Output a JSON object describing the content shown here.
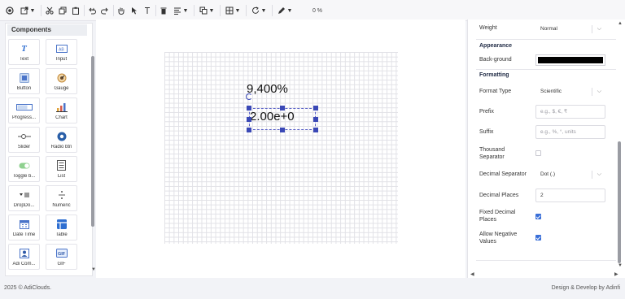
{
  "toolbar": {
    "zoom_label": "0 %",
    "icons": [
      "record-icon",
      "export-icon",
      "cut-icon",
      "copy-icon",
      "paste-icon",
      "undo-icon",
      "redo-icon",
      "hand-icon",
      "pointer-icon",
      "text-cursor-icon",
      "delete-icon",
      "align-icon",
      "layers-icon",
      "grid-icon",
      "refresh-icon",
      "pen-icon"
    ]
  },
  "components": {
    "title": "Components",
    "items": [
      {
        "label": "Text",
        "icon": "text-icon"
      },
      {
        "label": "Input",
        "icon": "input-icon"
      },
      {
        "label": "Button",
        "icon": "button-icon"
      },
      {
        "label": "Gauge",
        "icon": "gauge-icon"
      },
      {
        "label": "Progress...",
        "icon": "progress-icon"
      },
      {
        "label": "Chart",
        "icon": "chart-icon"
      },
      {
        "label": "Slider",
        "icon": "slider-icon"
      },
      {
        "label": "Radio btn",
        "icon": "radio-icon"
      },
      {
        "label": "Toggle b...",
        "icon": "toggle-icon"
      },
      {
        "label": "List",
        "icon": "list-icon"
      },
      {
        "label": "DropDo...",
        "icon": "dropdown-icon"
      },
      {
        "label": "Numeric",
        "icon": "numeric-icon"
      },
      {
        "label": "Date Time",
        "icon": "calendar-icon"
      },
      {
        "label": "Table",
        "icon": "table-icon"
      },
      {
        "label": "Adi Com...",
        "icon": "component-icon"
      },
      {
        "label": "GIF",
        "icon": "gif-icon"
      }
    ]
  },
  "canvas": {
    "text_top": "9,400%",
    "text_selected": "2.00e+0"
  },
  "properties": {
    "weight_label": "Weight",
    "weight_value": "Normal",
    "appearance_title": "Appearance",
    "background_label": "Back-ground",
    "background_color": "#000000",
    "formatting_title": "Formatting",
    "format_type_label": "Format Type",
    "format_type_value": "Scientific",
    "prefix_label": "Prefix",
    "prefix_placeholder": "e.g., $, €, ₹",
    "suffix_label": "Suffix",
    "suffix_placeholder": "e.g., %, °, units",
    "thousand_separator_label": "Thousand Separator",
    "decimal_separator_label": "Decimal Separator",
    "decimal_separator_value": "Dot (.)",
    "decimal_places_label": "Decimal Places",
    "decimal_places_value": "2",
    "fixed_decimal_label": "Fixed Decimal Places",
    "allow_negative_label": "Allow Negative Values"
  },
  "footer": {
    "copyright": "2025 © AdiClouds.",
    "credit": "Design & Develop by Adinfi"
  }
}
